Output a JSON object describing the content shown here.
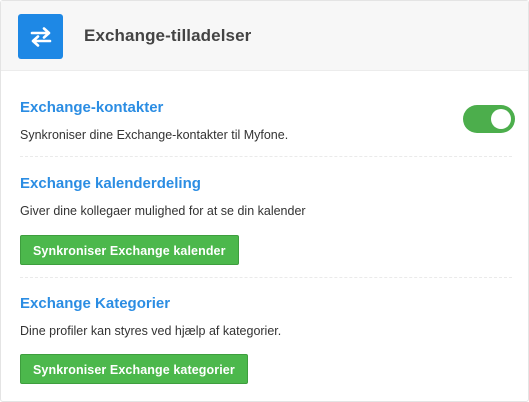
{
  "header": {
    "title": "Exchange-tilladelser",
    "icon": "swap-arrows-icon",
    "icon_bg": "#1e88e5"
  },
  "sections": {
    "contacts": {
      "title": "Exchange-kontakter",
      "description": "Synkroniser dine Exchange-kontakter til Myfone.",
      "toggle_on": true
    },
    "calendar": {
      "title": "Exchange kalenderdeling",
      "description": "Giver dine kollegaer mulighed for at se din kalender",
      "button_label": "Synkroniser Exchange kalender"
    },
    "categories": {
      "title": "Exchange Kategorier",
      "description": "Dine profiler kan styres ved hjælp af kategorier.",
      "button_label": "Synkroniser Exchange kategorier"
    }
  },
  "colors": {
    "accent_blue": "#2b8de3",
    "success_green": "#4cb84c"
  }
}
